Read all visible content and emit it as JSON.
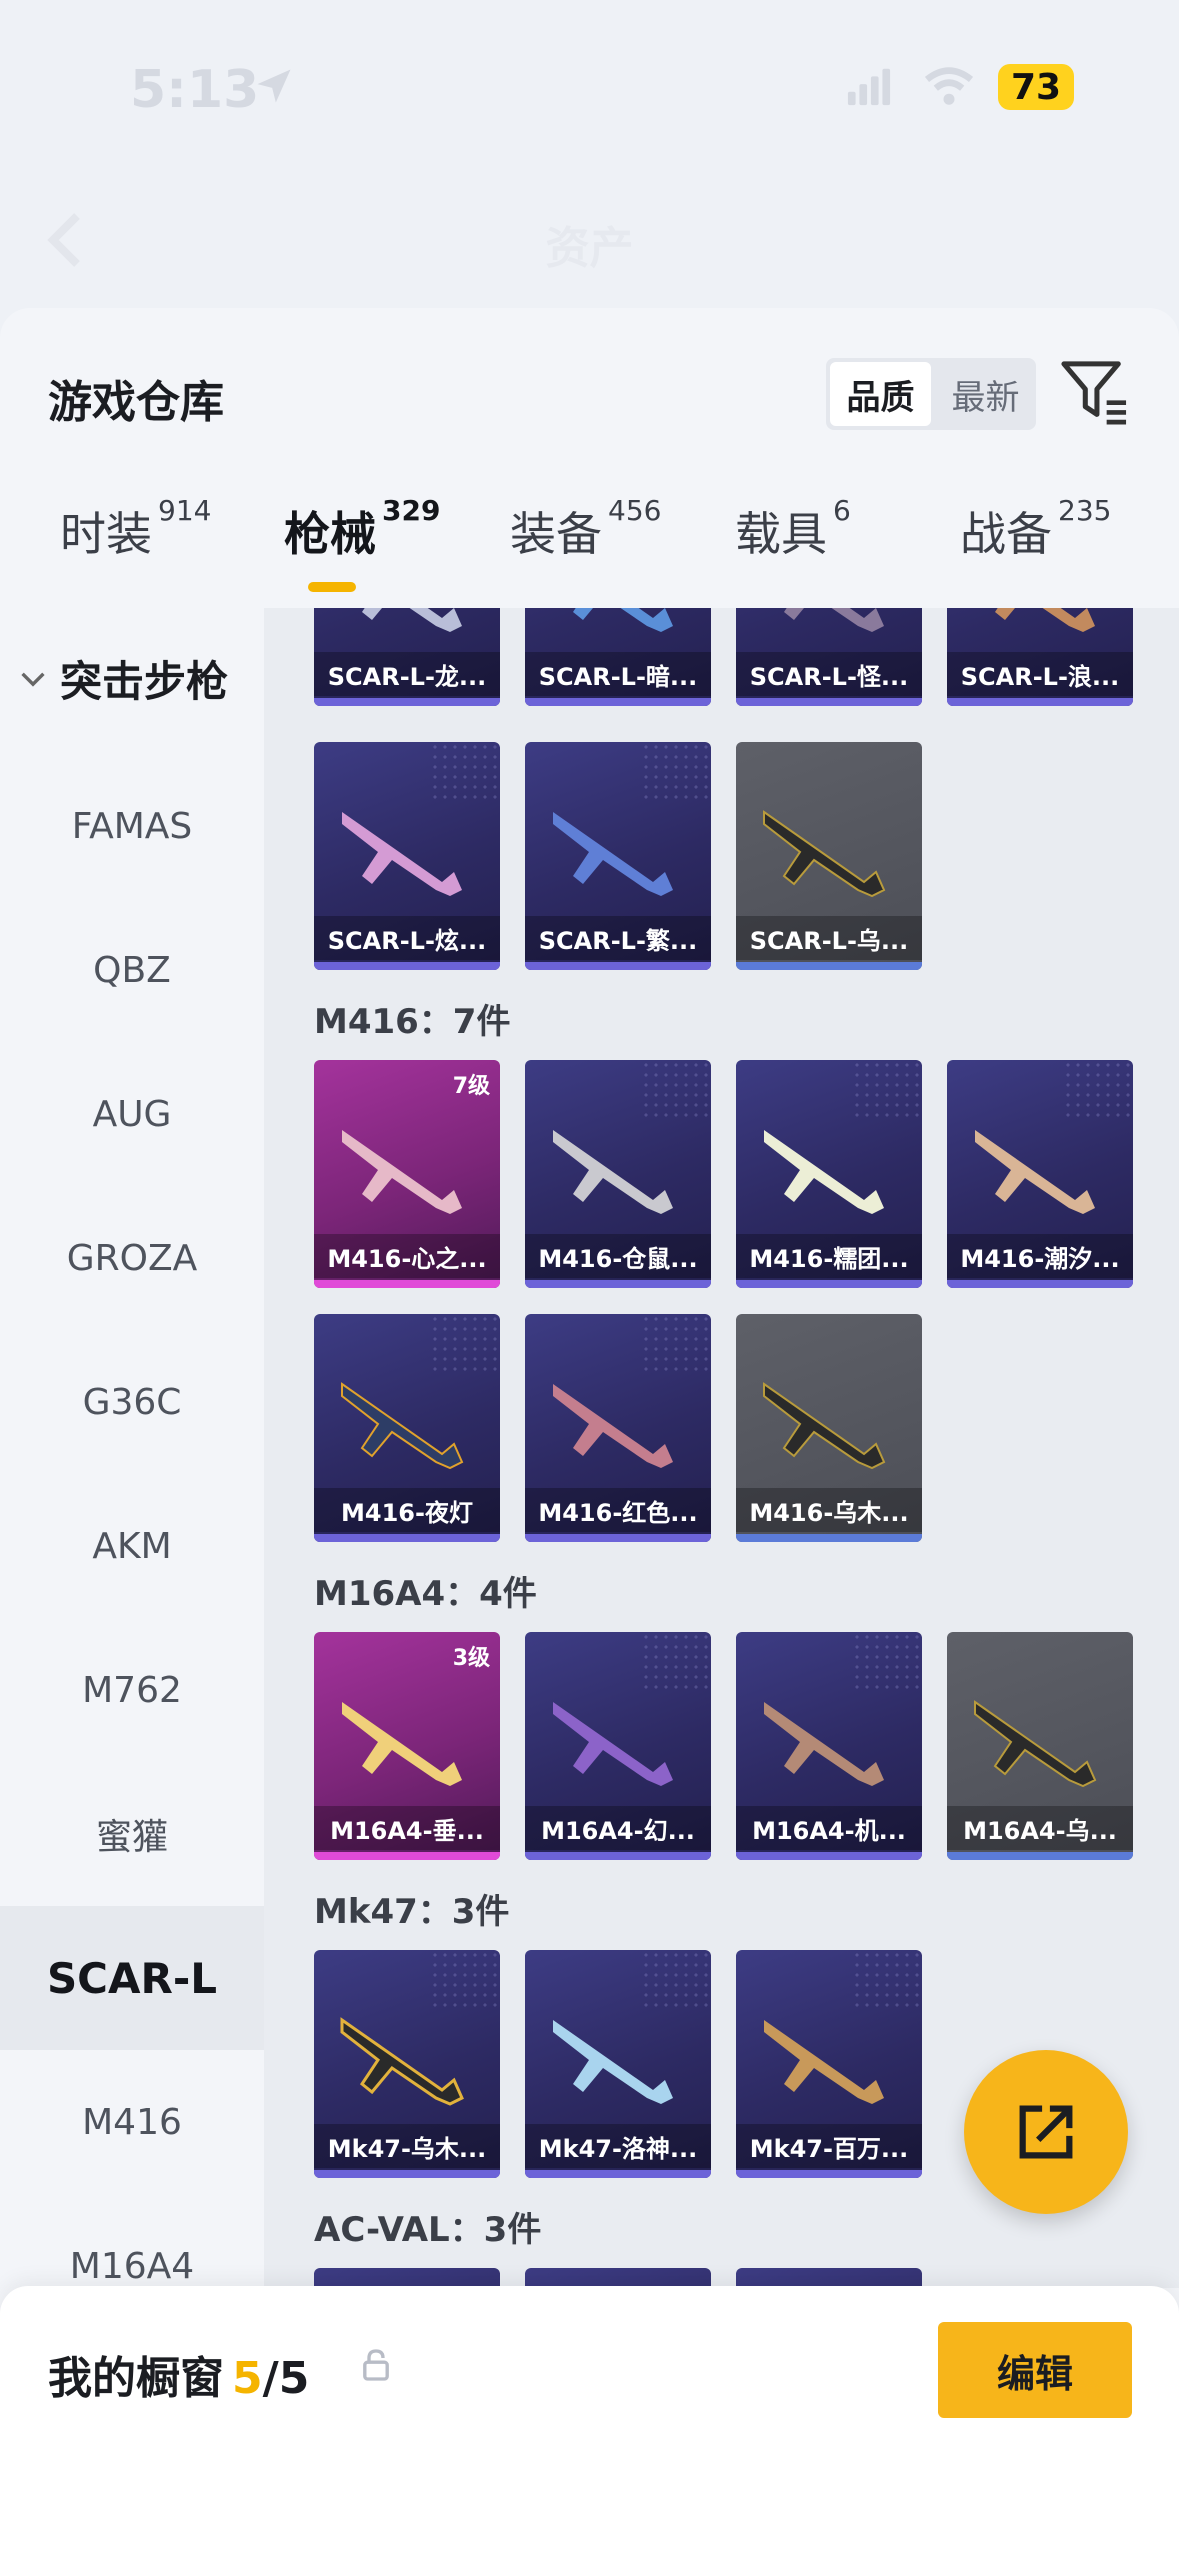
{
  "status_bar": {
    "time": "5:13",
    "battery": "73"
  },
  "nav": {
    "title": "资产"
  },
  "sheet": {
    "title": "游戏仓库",
    "sort_options": [
      {
        "label": "品质"
      },
      {
        "label": "最新"
      }
    ]
  },
  "tabs": [
    {
      "label": "时装",
      "count": "914"
    },
    {
      "label": "枪械",
      "count": "329"
    },
    {
      "label": "装备",
      "count": "456"
    },
    {
      "label": "载具",
      "count": "6"
    },
    {
      "label": "战备",
      "count": "235"
    }
  ],
  "sidebar": {
    "group": "突击步枪",
    "items": [
      {
        "label": "FAMAS"
      },
      {
        "label": "QBZ"
      },
      {
        "label": "AUG"
      },
      {
        "label": "GROZA"
      },
      {
        "label": "G36C"
      },
      {
        "label": "AKM"
      },
      {
        "label": "M762"
      },
      {
        "label": "蜜獾"
      },
      {
        "label": "SCAR-L"
      },
      {
        "label": "M416"
      },
      {
        "label": "M16A4"
      }
    ]
  },
  "sections": {
    "scar_top": [
      {
        "label": "SCAR-L-龙..."
      },
      {
        "label": "SCAR-L-暗..."
      },
      {
        "label": "SCAR-L-怪..."
      },
      {
        "label": "SCAR-L-浪..."
      }
    ],
    "scar_more": [
      {
        "label": "SCAR-L-炫..."
      },
      {
        "label": "SCAR-L-繁..."
      },
      {
        "label": "SCAR-L-乌..."
      }
    ],
    "m416": {
      "header": "M416：7件",
      "items": [
        {
          "label": "M416-心之...",
          "level": "7级"
        },
        {
          "label": "M416-仓鼠..."
        },
        {
          "label": "M416-糯团..."
        },
        {
          "label": "M416-潮汐..."
        },
        {
          "label": "M416-夜灯"
        },
        {
          "label": "M416-红色..."
        },
        {
          "label": "M416-乌木..."
        }
      ]
    },
    "m16a4": {
      "header": "M16A4：4件",
      "items": [
        {
          "label": "M16A4-垂...",
          "level": "3级"
        },
        {
          "label": "M16A4-幻..."
        },
        {
          "label": "M16A4-机..."
        },
        {
          "label": "M16A4-乌..."
        }
      ]
    },
    "mk47": {
      "header": "Mk47：3件",
      "items": [
        {
          "label": "Mk47-乌木..."
        },
        {
          "label": "Mk47-洛神..."
        },
        {
          "label": "Mk47-百万..."
        }
      ]
    },
    "acval": {
      "header": "AC-VAL：3件"
    }
  },
  "bottom_bar": {
    "label": "我的橱窗",
    "count": "5",
    "total": "/5",
    "edit_label": "编辑"
  },
  "colors": {
    "accent": "#f5b400",
    "card_purple": "#2d2a63",
    "card_pink": "#7b2578",
    "card_gray": "#4c4e56"
  }
}
